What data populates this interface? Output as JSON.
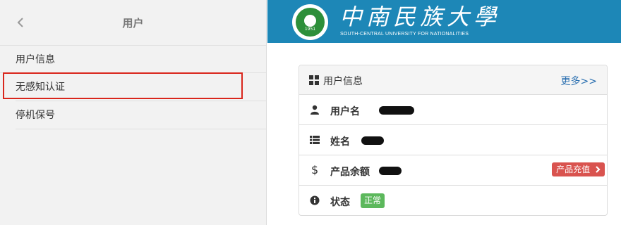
{
  "sidebar": {
    "back_icon": "chevron-left-icon",
    "title": "用户",
    "items": [
      {
        "label": "用户信息"
      },
      {
        "label": "无感知认证"
      },
      {
        "label": "停机保号"
      }
    ]
  },
  "banner": {
    "logo_year": "1951",
    "name_cn": "中南民族大學",
    "name_en": "SOUTH-CENTRAL UNIVERSITY FOR NATIONALITIES",
    "bg_color": "#1d87b7"
  },
  "panel": {
    "icon": "th-large-icon",
    "title": "用户信息",
    "more_link": "更多>>",
    "rows": [
      {
        "icon": "user-icon",
        "label": "用户名"
      },
      {
        "icon": "list-icon",
        "label": "姓名"
      },
      {
        "icon": "dollar-icon",
        "label": "产品余额",
        "action": "产品充值"
      },
      {
        "icon": "info-icon",
        "label": "状态",
        "status": "正常"
      }
    ]
  },
  "colors": {
    "highlight": "#d9261c",
    "danger": "#d9534f",
    "success": "#5cb85c",
    "link": "#2a6fb0"
  }
}
